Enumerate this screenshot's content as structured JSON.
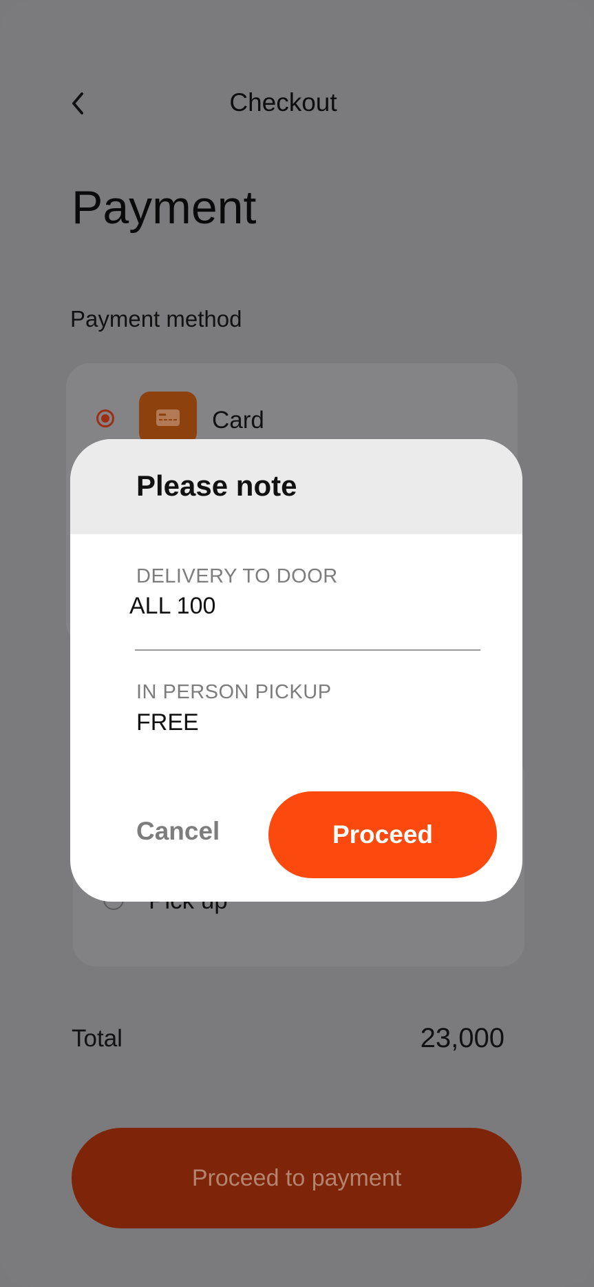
{
  "header": {
    "title": "Checkout",
    "back_icon": "chevron-left-icon"
  },
  "page": {
    "title": "Payment"
  },
  "payment_method": {
    "section_label": "Payment method",
    "options": [
      {
        "label": "Card",
        "selected": true,
        "icon": "credit-card-icon"
      }
    ]
  },
  "delivery": {
    "options": [
      {
        "label": "Pick up",
        "selected": false
      }
    ]
  },
  "total": {
    "label": "Total",
    "value": "23,000"
  },
  "primary_button": {
    "label": "Proceed to payment"
  },
  "modal": {
    "title": "Please note",
    "items": [
      {
        "label": "DELIVERY TO DOOR",
        "value": "ALL 100"
      },
      {
        "label": "IN PERSON PICKUP",
        "value": "FREE"
      }
    ],
    "cancel_label": "Cancel",
    "proceed_label": "Proceed"
  },
  "colors": {
    "accent": "#fc4a0f",
    "overlay": "#7b7b7d",
    "modal_header": "#ebebeb"
  }
}
